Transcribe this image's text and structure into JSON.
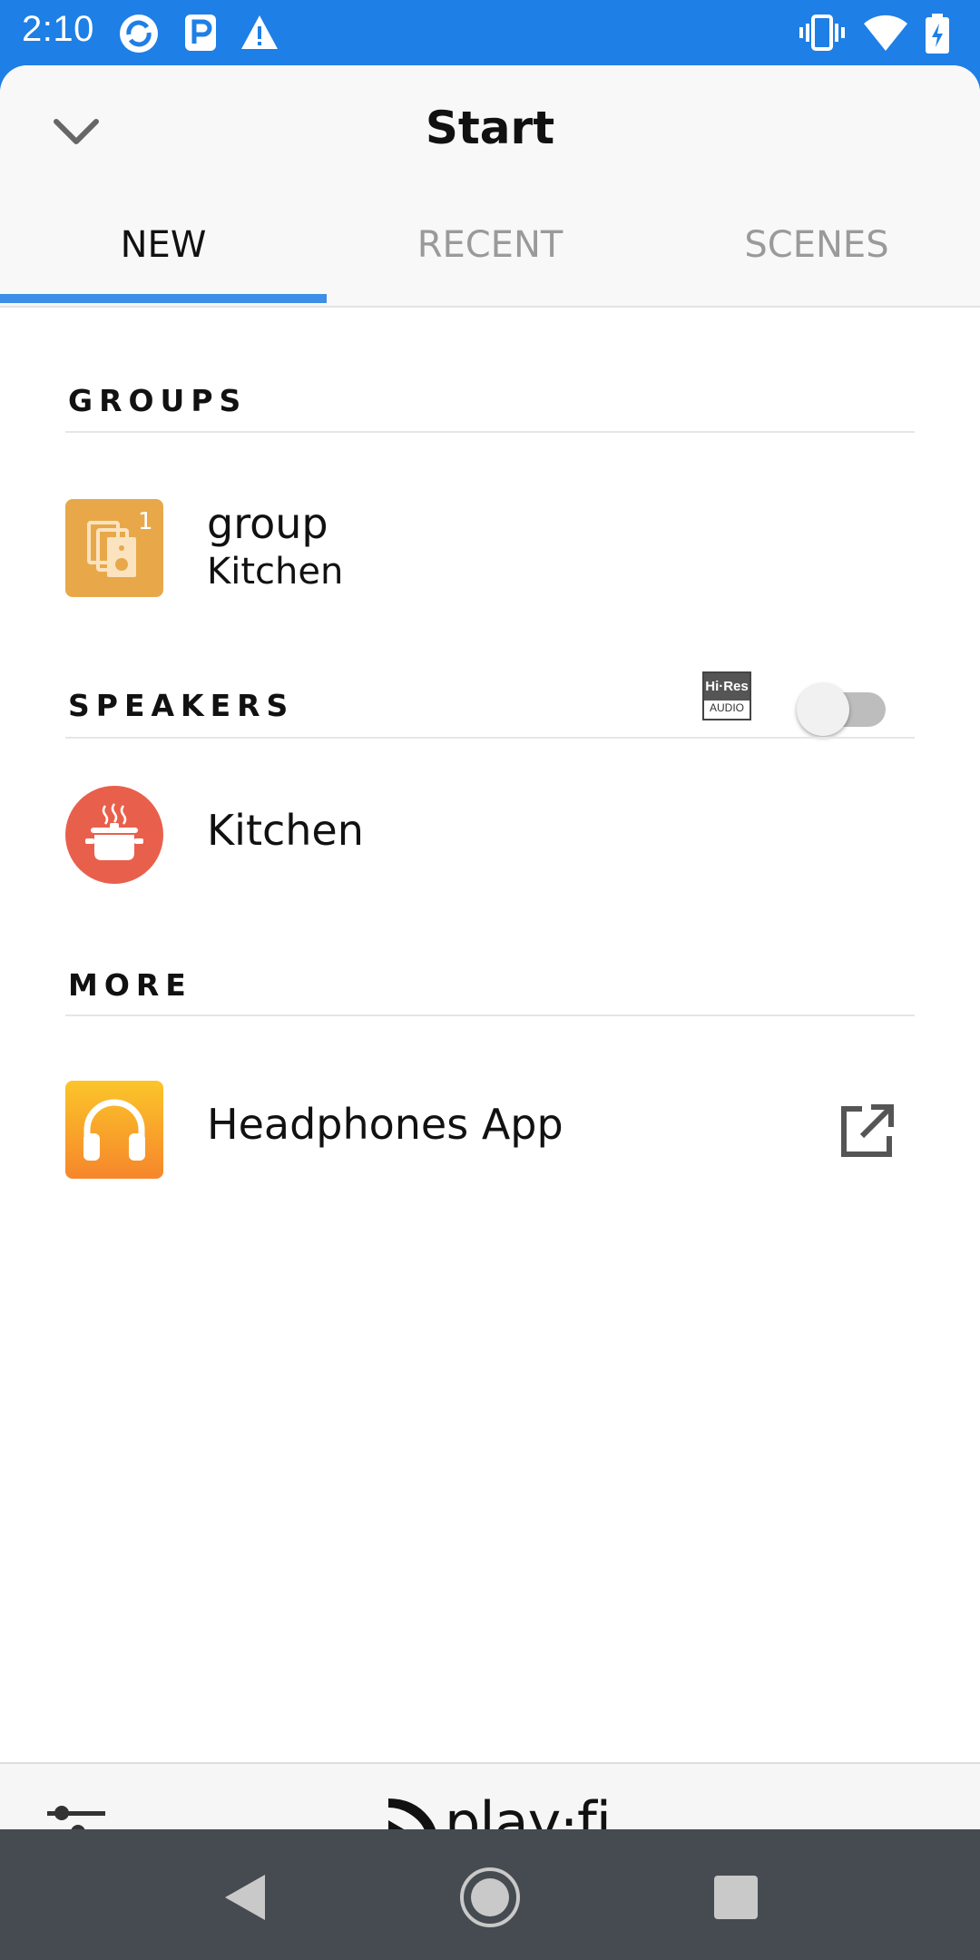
{
  "status_bar": {
    "time": "2:10",
    "left_icons": [
      "sync-icon",
      "parking-icon",
      "warning-icon"
    ],
    "right_icons": [
      "vibrate-icon",
      "wifi-icon",
      "battery-charging-icon"
    ]
  },
  "header": {
    "title": "Start",
    "collapse_icon": "chevron-down-icon"
  },
  "tabs": [
    {
      "label": "NEW",
      "active": true
    },
    {
      "label": "RECENT",
      "active": false
    },
    {
      "label": "SCENES",
      "active": false
    }
  ],
  "groups": {
    "title": "GROUPS",
    "items": [
      {
        "name": "group",
        "subtitle": "Kitchen",
        "icon": "speaker-group-icon",
        "badge": "1",
        "color": "#e8a84a"
      }
    ]
  },
  "speakers": {
    "title": "SPEAKERS",
    "hires_badge_top": "Hi·Res",
    "hires_badge_bottom": "AUDIO",
    "hires_toggle_on": false,
    "items": [
      {
        "name": "Kitchen",
        "icon": "cooking-pot-icon",
        "color": "#e8604c"
      }
    ]
  },
  "more": {
    "title": "MORE",
    "items": [
      {
        "name": "Headphones App",
        "icon": "headphones-icon",
        "color": "#f99b24",
        "action_icon": "open-external-icon"
      }
    ]
  },
  "bottom_bar": {
    "settings_icon": "equalizer-icon",
    "logo_text": "play·fi"
  },
  "nav_bar": {
    "buttons": [
      "back-icon",
      "home-icon",
      "recents-icon"
    ]
  },
  "colors": {
    "accent": "#1e7fe6",
    "tab_indicator": "#3d8ee6",
    "nav_bar": "#454b51"
  }
}
